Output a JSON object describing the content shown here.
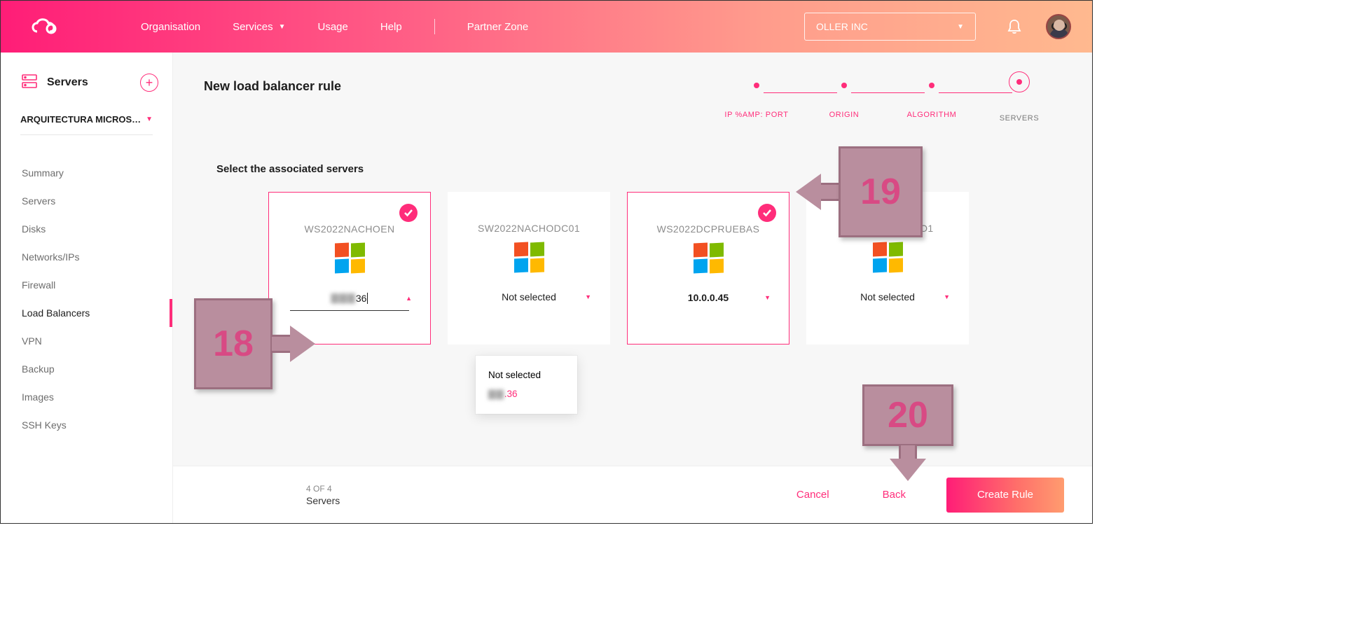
{
  "header": {
    "nav": {
      "organisation": "Organisation",
      "services": "Services",
      "usage": "Usage",
      "help": "Help",
      "partner": "Partner Zone"
    },
    "org_selected": "OLLER INC"
  },
  "sidebar": {
    "section_label": "Servers",
    "project": "ARQUITECTURA MICROS…",
    "items": [
      {
        "label": "Summary"
      },
      {
        "label": "Servers"
      },
      {
        "label": "Disks"
      },
      {
        "label": "Networks/IPs"
      },
      {
        "label": "Firewall"
      },
      {
        "label": "Load Balancers"
      },
      {
        "label": "VPN"
      },
      {
        "label": "Backup"
      },
      {
        "label": "Images"
      },
      {
        "label": "SSH Keys"
      }
    ],
    "active_index": 5
  },
  "page": {
    "title": "New load balancer rule",
    "section": "Select the associated servers"
  },
  "stepper": {
    "steps": [
      {
        "label": "IP %AMP: PORT"
      },
      {
        "label": "ORIGIN"
      },
      {
        "label": "ALGORITHM"
      },
      {
        "label": "SERVERS"
      }
    ]
  },
  "servers": [
    {
      "name": "WS2022NACHOEN",
      "ip_blur": "▇▇▇",
      "ip_suffix": "36",
      "selected": true,
      "open": true
    },
    {
      "name": "SW2022NACHODC01",
      "ip_text": "Not selected",
      "selected": false
    },
    {
      "name": "WS2022DCPRUEBAS",
      "ip_text": "10.0.0.45",
      "selected": true
    },
    {
      "name": "SW22DNSNACHO1",
      "ip_text": "Not selected",
      "selected": false
    }
  ],
  "dropdown": {
    "opt0": "Not selected",
    "opt1_blur": "▇▇",
    "opt1_suffix": ".36"
  },
  "footer": {
    "progress": "4 OF 4",
    "progress_label": "Servers",
    "cancel": "Cancel",
    "back": "Back",
    "create": "Create Rule"
  },
  "annotations": {
    "a18": "18",
    "a19": "19",
    "a20": "20"
  }
}
